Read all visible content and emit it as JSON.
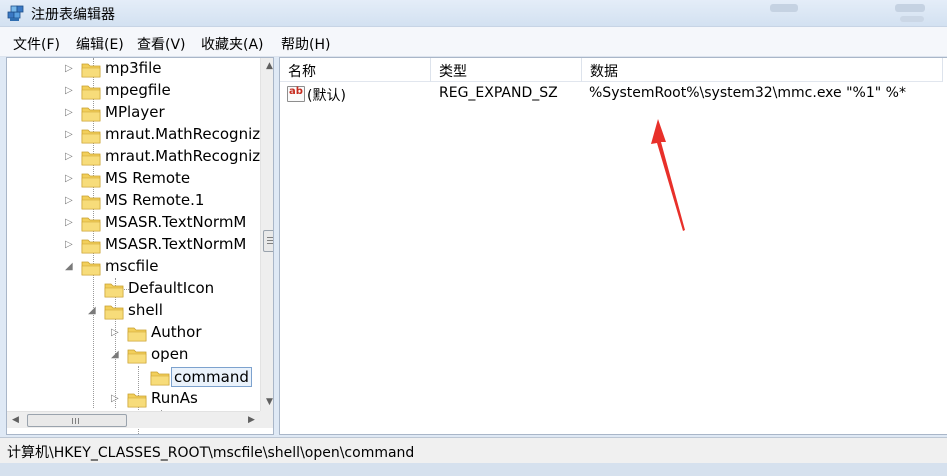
{
  "window": {
    "title": "注册表编辑器"
  },
  "menu": [
    "文件(F)",
    "编辑(E)",
    "查看(V)",
    "收藏夹(A)",
    "帮助(H)"
  ],
  "tree": {
    "items": [
      {
        "label": "mp3file",
        "level": 0,
        "expander": "collapsed"
      },
      {
        "label": "mpegfile",
        "level": 0,
        "expander": "collapsed"
      },
      {
        "label": "MPlayer",
        "level": 0,
        "expander": "collapsed"
      },
      {
        "label": "mraut.MathRecogniz",
        "level": 0,
        "expander": "collapsed"
      },
      {
        "label": "mraut.MathRecogniz",
        "level": 0,
        "expander": "collapsed"
      },
      {
        "label": "MS Remote",
        "level": 0,
        "expander": "collapsed"
      },
      {
        "label": "MS Remote.1",
        "level": 0,
        "expander": "collapsed"
      },
      {
        "label": "MSASR.TextNormM",
        "level": 0,
        "expander": "collapsed"
      },
      {
        "label": "MSASR.TextNormM",
        "level": 0,
        "expander": "collapsed"
      },
      {
        "label": "mscfile",
        "level": 0,
        "expander": "expanded"
      },
      {
        "label": "DefaultIcon",
        "level": 1,
        "expander": "none"
      },
      {
        "label": "shell",
        "level": 1,
        "expander": "expanded"
      },
      {
        "label": "Author",
        "level": 2,
        "expander": "collapsed"
      },
      {
        "label": "open",
        "level": 2,
        "expander": "expanded"
      },
      {
        "label": "command",
        "level": 3,
        "expander": "none",
        "selected": true
      },
      {
        "label": "RunAs",
        "level": 2,
        "expander": "collapsed"
      }
    ]
  },
  "list": {
    "columns": [
      "名称",
      "类型",
      "数据"
    ],
    "rows": [
      {
        "name": "(默认)",
        "type": "REG_EXPAND_SZ",
        "data": "%SystemRoot%\\system32\\mmc.exe \"%1\" %*",
        "icon": "ab-string-icon"
      }
    ]
  },
  "status": {
    "path": "计算机\\HKEY_CLASSES_ROOT\\mscfile\\shell\\open\\command"
  },
  "colors": {
    "annotation_arrow": "#e8302a",
    "selection_border": "#7da2ce",
    "folder": "#f2cf5b"
  }
}
